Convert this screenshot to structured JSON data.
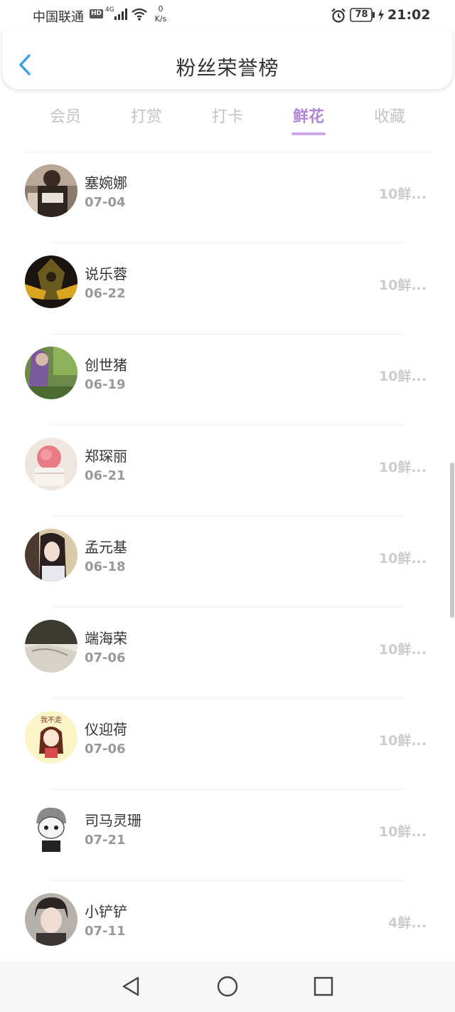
{
  "status_bar": {
    "carrier": "中国联通",
    "hd": "HD",
    "net_type": "4G",
    "speed_value": "0",
    "speed_unit": "K/s",
    "battery": "78",
    "time": "21:02"
  },
  "header": {
    "title": "粉丝荣誉榜",
    "back_icon": "chevron-left-icon"
  },
  "tabs": [
    {
      "label": "会员",
      "active": false
    },
    {
      "label": "打赏",
      "active": false
    },
    {
      "label": "打卡",
      "active": false
    },
    {
      "label": "鲜花",
      "active": true
    },
    {
      "label": "收藏",
      "active": false
    }
  ],
  "colors": {
    "accent": "#b085d8",
    "indicator": "#cda8ea",
    "back_arrow": "#3aa0e8",
    "inactive_tab": "#c4c4c4"
  },
  "fans": [
    {
      "name": "塞婉娜",
      "date": "07-04",
      "count": "10鲜..."
    },
    {
      "name": "说乐蓉",
      "date": "06-22",
      "count": "10鲜..."
    },
    {
      "name": "创世猪",
      "date": "06-19",
      "count": "10鲜..."
    },
    {
      "name": "郑琛丽",
      "date": "06-21",
      "count": "10鲜..."
    },
    {
      "name": "孟元基",
      "date": "06-18",
      "count": "10鲜..."
    },
    {
      "name": "端海荣",
      "date": "07-06",
      "count": "10鲜..."
    },
    {
      "name": "仪迎荷",
      "date": "07-06",
      "count": "10鲜..."
    },
    {
      "name": "司马灵珊",
      "date": "07-21",
      "count": "10鲜..."
    },
    {
      "name": "小铲铲",
      "date": "07-11",
      "count": "4鲜..."
    }
  ],
  "avatar_badge_text": "我不走",
  "nav_bar": {
    "back_icon": "triangle-back-icon",
    "home_icon": "circle-home-icon",
    "recent_icon": "square-recent-icon"
  }
}
